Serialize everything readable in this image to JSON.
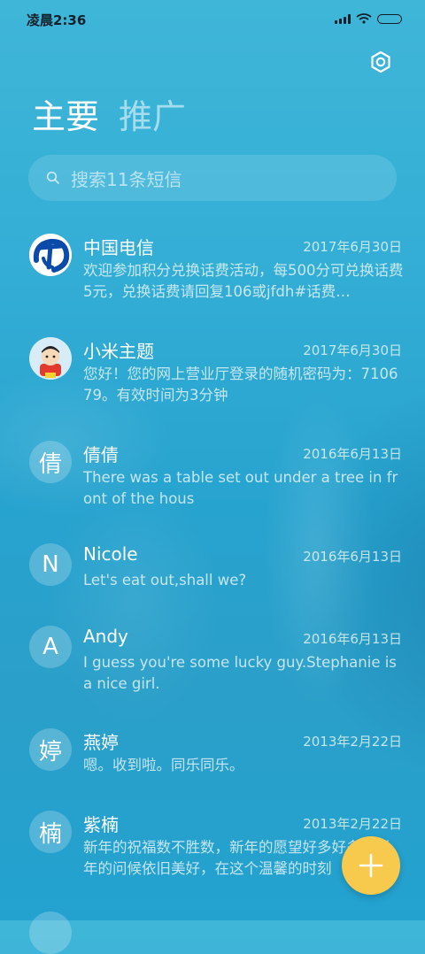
{
  "status_bar": {
    "time": "凌晨2:36"
  },
  "tabs": [
    {
      "label": "主要"
    },
    {
      "label": "推广"
    }
  ],
  "search": {
    "placeholder": "搜索11条短信"
  },
  "messages": [
    {
      "name": "中国电信",
      "date": "2017年6月30日",
      "preview": "欢迎参加积分兑换话费活动，每500分可兑换话费5元，兑换话费请回复106或jfdh#话费…",
      "avatar": "china-telecom-logo"
    },
    {
      "name": "小米主题",
      "date": "2017年6月30日",
      "preview": "您好！您的网上营业厅登录的随机密码为：710679。有效时间为3分钟",
      "avatar": "cartoon-avatar"
    },
    {
      "name": "倩倩",
      "date": "2016年6月13日",
      "preview": "There was a table set out under a tree in front of the hous",
      "avatar_text": "倩"
    },
    {
      "name": "Nicole",
      "date": "2016年6月13日",
      "preview": "Let's eat out,shall we?",
      "avatar_text": "N"
    },
    {
      "name": "Andy",
      "date": "2016年6月13日",
      "preview": "I guess you're some lucky guy.Stephanie is a nice girl.",
      "avatar_text": "A"
    },
    {
      "name": "燕婷",
      "date": "2013年2月22日",
      "preview": "嗯。收到啦。同乐同乐。",
      "avatar_text": "婷"
    },
    {
      "name": "紫楠",
      "date": "2013年2月22日",
      "preview": "新年的祝福数不胜数，新年的愿望好多好多，新年的问候依旧美好，在这个温馨的时刻",
      "avatar_text": "楠"
    }
  ],
  "colors": {
    "fab": "#f7c94d",
    "background": "#2aa8d2"
  },
  "icons": {
    "settings": "gear-icon",
    "search": "search-icon",
    "compose": "plus-icon"
  }
}
